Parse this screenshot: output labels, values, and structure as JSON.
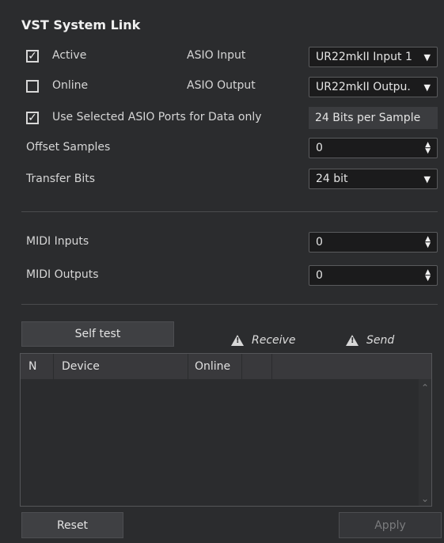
{
  "title": "VST System Link",
  "active": {
    "label": "Active",
    "checked": true,
    "check_glyph": "✓"
  },
  "online": {
    "label": "Online",
    "checked": false
  },
  "use_selected": {
    "label": "Use Selected ASIO Ports for Data only",
    "checked": true,
    "check_glyph": "✓"
  },
  "asio_input": {
    "label": "ASIO Input",
    "value": "UR22mkII Input 1"
  },
  "asio_output": {
    "label": "ASIO Output",
    "value": "UR22mkII Outpu."
  },
  "bits_per_sample": "24 Bits per Sample",
  "offset_samples": {
    "label": "Offset Samples",
    "value": "0"
  },
  "transfer_bits": {
    "label": "Transfer Bits",
    "value": "24 bit"
  },
  "midi_inputs": {
    "label": "MIDI Inputs",
    "value": "0"
  },
  "midi_outputs": {
    "label": "MIDI Outputs",
    "value": "0"
  },
  "self_test_label": "Self test",
  "receive_label": "Receive",
  "send_label": "Send",
  "table": {
    "columns": [
      "N",
      "Device",
      "Online",
      "",
      ""
    ]
  },
  "reset_label": "Reset",
  "apply_label": "Apply",
  "icons": {
    "dropdown": "▼",
    "spin_up": "▲",
    "spin_down": "▼",
    "scroll_up": "⌃",
    "scroll_down": "⌄"
  }
}
